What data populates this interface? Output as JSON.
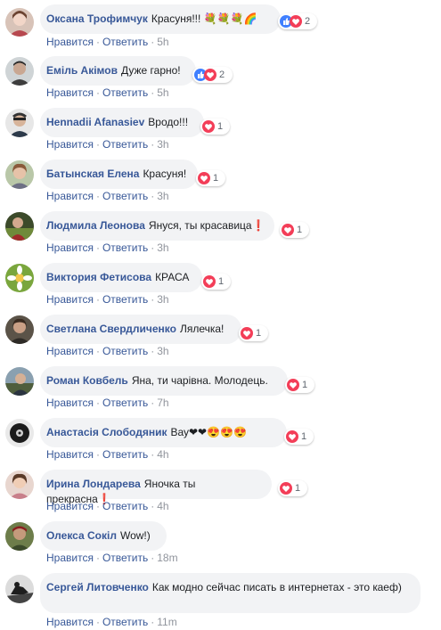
{
  "actions": {
    "like": "Нравится",
    "reply": "Ответить",
    "sep": "·"
  },
  "colors": {
    "link": "#385898",
    "bubble": "#f2f3f5",
    "meta": "#90949c",
    "love": "#f33e58",
    "like": "#4080ff"
  },
  "comments": [
    {
      "author": "Оксана Трофимчук",
      "text": "Красуня!!! 💐💐💐🌈",
      "reactions": [
        "like-icon",
        "love-icon"
      ],
      "count": "2",
      "time": "5h"
    },
    {
      "author": "Еміль Акімов",
      "text": "Дуже гарно!",
      "reactions": [
        "like-icon",
        "love-icon"
      ],
      "count": "2",
      "time": "5h"
    },
    {
      "author": "Hennadii Afanasiev",
      "text": "Вродо!!!",
      "reactions": [
        "love-icon"
      ],
      "count": "1",
      "time": "3h"
    },
    {
      "author": "Батынская Елена",
      "text": "Красуня!",
      "reactions": [
        "love-icon"
      ],
      "count": "1",
      "time": "3h"
    },
    {
      "author": "Людмила Леонова",
      "text": "Януся, ты красавица❗",
      "reactions": [
        "love-icon"
      ],
      "count": "1",
      "time": "3h"
    },
    {
      "author": "Виктория Фетисова",
      "text": "КРАСА",
      "reactions": [
        "love-icon"
      ],
      "count": "1",
      "time": "3h"
    },
    {
      "author": "Светлана Свердличенко",
      "text": "Лялечка!",
      "reactions": [
        "love-icon"
      ],
      "count": "1",
      "time": "3h"
    },
    {
      "author": "Роман Ковбель",
      "text": "Яна, ти чарівна. Молодець.",
      "reactions": [
        "love-icon"
      ],
      "count": "1",
      "time": "7h"
    },
    {
      "author": "Анастасія Слободяник",
      "text": "Вау❤❤😍😍😍",
      "reactions": [
        "love-icon"
      ],
      "count": "1",
      "time": "4h"
    },
    {
      "author": "Ирина Лондарева",
      "text": "Яночка ты прекрасна❗",
      "reactions": [
        "love-icon"
      ],
      "count": "1",
      "time": "4h"
    },
    {
      "author": "Олекса Сокіл",
      "text": "Wow!)",
      "reactions": [],
      "count": "",
      "time": "18m"
    },
    {
      "author": "Сергей Литовченко",
      "text": "Как модно сейчас писать в интернетах - это кaеф)",
      "reactions": [],
      "count": "",
      "time": "11m"
    }
  ]
}
